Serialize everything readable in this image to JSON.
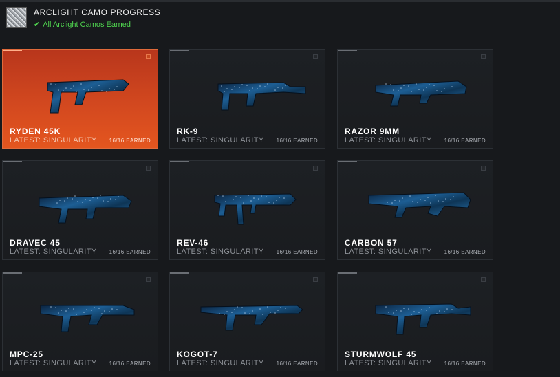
{
  "header": {
    "title": "ARCLIGHT CAMO PROGRESS",
    "status": "All Arclight Camos Earned",
    "status_color": "#4fd44f"
  },
  "accent_color": "#d2481f",
  "cards": [
    {
      "name": "RYDEN 45K",
      "latest": "LATEST: SINGULARITY",
      "earned": "16/16 EARNED",
      "selected": true,
      "icon": "smg-icon"
    },
    {
      "name": "RK-9",
      "latest": "LATEST: SINGULARITY",
      "earned": "16/16 EARNED",
      "selected": false,
      "icon": "smg-icon"
    },
    {
      "name": "RAZOR 9MM",
      "latest": "LATEST: SINGULARITY",
      "earned": "16/16 EARNED",
      "selected": false,
      "icon": "smg-icon"
    },
    {
      "name": "DRAVEC 45",
      "latest": "LATEST: SINGULARITY",
      "earned": "16/16 EARNED",
      "selected": false,
      "icon": "smg-icon"
    },
    {
      "name": "REV-46",
      "latest": "LATEST: SINGULARITY",
      "earned": "16/16 EARNED",
      "selected": false,
      "icon": "smg-icon"
    },
    {
      "name": "CARBON 57",
      "latest": "LATEST: SINGULARITY",
      "earned": "16/16 EARNED",
      "selected": false,
      "icon": "smg-icon"
    },
    {
      "name": "MPC-25",
      "latest": "LATEST: SINGULARITY",
      "earned": "16/16 EARNED",
      "selected": false,
      "icon": "smg-icon"
    },
    {
      "name": "KOGOT-7",
      "latest": "LATEST: SINGULARITY",
      "earned": "16/16 EARNED",
      "selected": false,
      "icon": "smg-icon"
    },
    {
      "name": "STURMWOLF 45",
      "latest": "LATEST: SINGULARITY",
      "earned": "16/16 EARNED",
      "selected": false,
      "icon": "smg-icon"
    }
  ]
}
